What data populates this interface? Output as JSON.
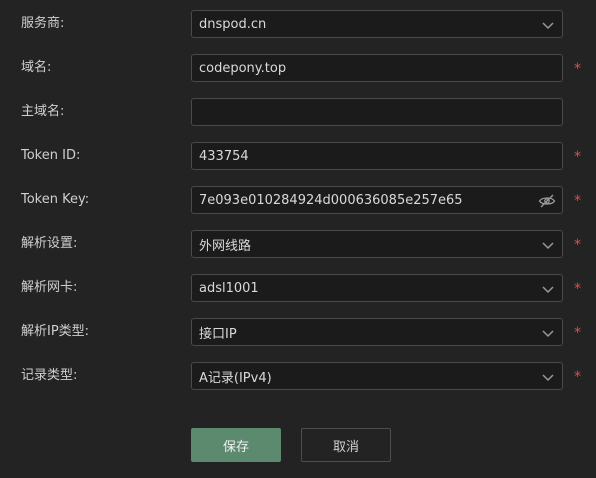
{
  "form": {
    "provider": {
      "label": "服务商:",
      "value": "dnspod.cn",
      "required": false
    },
    "domain": {
      "label": "域名:",
      "value": "codepony.top",
      "required": true
    },
    "main_domain": {
      "label": "主域名:",
      "value": "",
      "placeholder": "",
      "required": false
    },
    "token_id": {
      "label": "Token ID:",
      "value": "433754",
      "required": true
    },
    "token_key": {
      "label": "Token Key:",
      "value": "7e093e010284924d000636085e257e65",
      "required": true
    },
    "resolve_setting": {
      "label": "解析设置:",
      "value": "外网线路",
      "required": true
    },
    "resolve_nic": {
      "label": "解析网卡:",
      "value": "adsl1001",
      "required": true
    },
    "resolve_ip_type": {
      "label": "解析IP类型:",
      "value": "接口IP",
      "required": true
    },
    "record_type": {
      "label": "记录类型:",
      "value": "A记录(IPv4)",
      "required": true
    },
    "required_mark": "*"
  },
  "buttons": {
    "save": "保存",
    "cancel": "取消"
  },
  "icons": {
    "select": "chevron-down-icon",
    "password_toggle": "eye-slash-icon"
  },
  "colors": {
    "accent": "#5b8a6f",
    "required": "#d9534f",
    "background": "#232323"
  }
}
